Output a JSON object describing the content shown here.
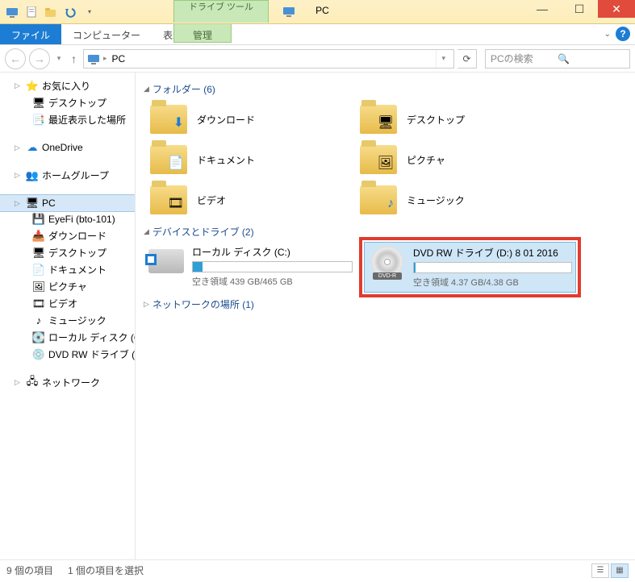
{
  "window": {
    "title": "PC",
    "tool_tab_top": "ドライブ ツール",
    "tool_tab_bottom": "管理"
  },
  "ribbon": {
    "file": "ファイル",
    "computer": "コンピューター",
    "view": "表示"
  },
  "nav": {
    "location": "PC",
    "search_placeholder": "PCの検索"
  },
  "sidebar": {
    "favorites": {
      "label": "お気に入り",
      "items": [
        "デスクトップ",
        "最近表示した場所"
      ]
    },
    "onedrive": "OneDrive",
    "homegroup": "ホームグループ",
    "pc": {
      "label": "PC",
      "items": [
        "EyeFi (bto-101)",
        "ダウンロード",
        "デスクトップ",
        "ドキュメント",
        "ピクチャ",
        "ビデオ",
        "ミュージック",
        "ローカル ディスク (C:)",
        "DVD RW ドライブ (D"
      ]
    },
    "network": "ネットワーク"
  },
  "sections": {
    "folders": {
      "label": "フォルダー (6)",
      "items": [
        {
          "name": "ダウンロード",
          "glyph": "↓"
        },
        {
          "name": "デスクトップ",
          "glyph": "🖥"
        },
        {
          "name": "ドキュメント",
          "glyph": "📄"
        },
        {
          "name": "ピクチャ",
          "glyph": "🖼"
        },
        {
          "name": "ビデオ",
          "glyph": "🎞"
        },
        {
          "name": "ミュージック",
          "glyph": "♪"
        }
      ]
    },
    "drives": {
      "label": "デバイスとドライブ (2)",
      "local": {
        "name": "ローカル ディスク (C:)",
        "free": "空き領域 439 GB/465 GB",
        "fillpct": 6
      },
      "dvd": {
        "name": "DVD RW ドライブ (D:) 8 01 2016",
        "free": "空き領域 4.37 GB/4.38 GB",
        "fillpct": 1
      }
    },
    "network": {
      "label": "ネットワークの場所 (1)"
    }
  },
  "status": {
    "count": "9 個の項目",
    "selected": "1 個の項目を選択"
  }
}
